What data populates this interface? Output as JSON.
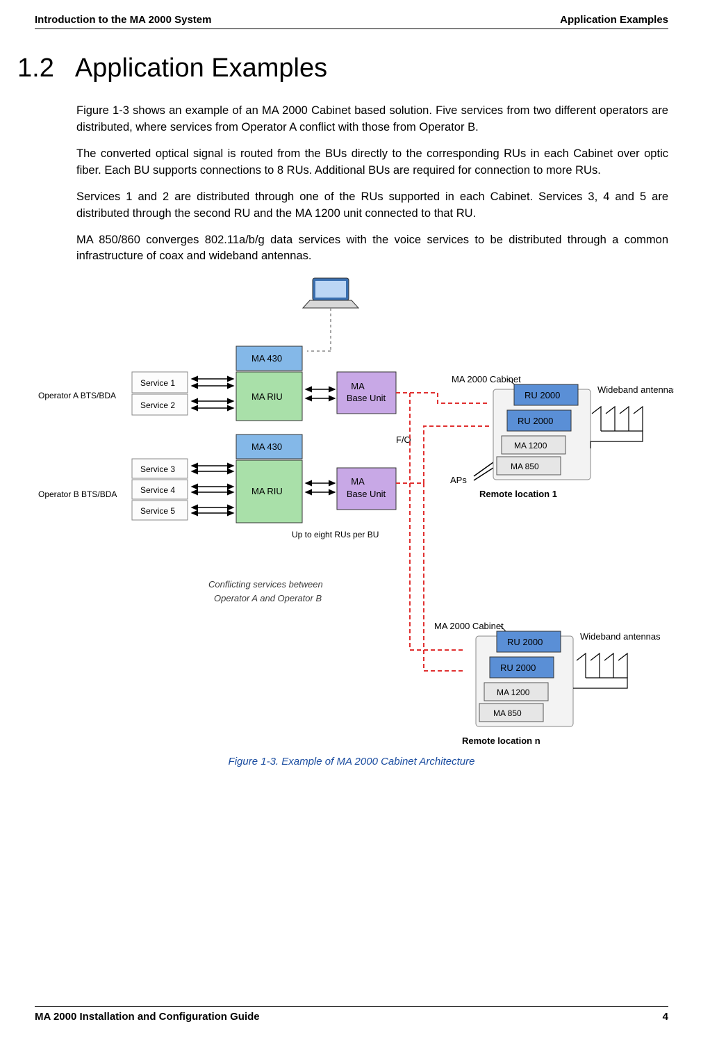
{
  "header": {
    "left": "Introduction to the MA 2000 System",
    "right": "Application Examples"
  },
  "section": {
    "number": "1.2",
    "title": "Application Examples"
  },
  "paragraphs": {
    "p1": "Figure 1-3 shows an example of an MA 2000 Cabinet based solution. Five services from two different operators are distributed, where services from Operator A conflict with those from Operator B.",
    "p2": "The converted optical signal is routed from the BUs directly to the corresponding RUs in each Cabinet over optic fiber. Each BU supports connections to 8 RUs. Additional BUs are required for connection to more RUs.",
    "p3": "Services 1 and 2 are distributed through one of the RUs supported in each Cabinet. Services 3, 4 and 5 are distributed through the second RU and the MA 1200 unit connected to that RU.",
    "p4": "MA 850/860 converges 802.11a/b/g data services with the voice services to be distributed through a common infrastructure of coax and wideband antennas."
  },
  "diagram": {
    "operatorA": "Operator A BTS/BDA",
    "operatorB": "Operator B BTS/BDA",
    "services": {
      "s1": "Service 1",
      "s2": "Service 2",
      "s3": "Service 3",
      "s4": "Service 4",
      "s5": "Service 5"
    },
    "ma430": "MA 430",
    "mariu": "MA RIU",
    "mabu": "MA",
    "mabu2": "Base Unit",
    "fo": "F/O",
    "aps": "APs",
    "upto": "Up to eight RUs per BU",
    "conflict1": "Conflicting services between",
    "conflict2": "Operator A  and Operator B",
    "cabinetLabel": "MA 2000 Cabinet",
    "ru2000": "RU 2000",
    "ma1200": "MA 1200",
    "ma850": "MA 850",
    "remote1": "Remote location 1",
    "remoten": "Remote location n",
    "wideband": "Wideband antennas"
  },
  "caption": "Figure 1-3. Example of MA 2000 Cabinet Architecture",
  "footer": {
    "left": "MA 2000 Installation and Configuration Guide",
    "right": "4"
  }
}
